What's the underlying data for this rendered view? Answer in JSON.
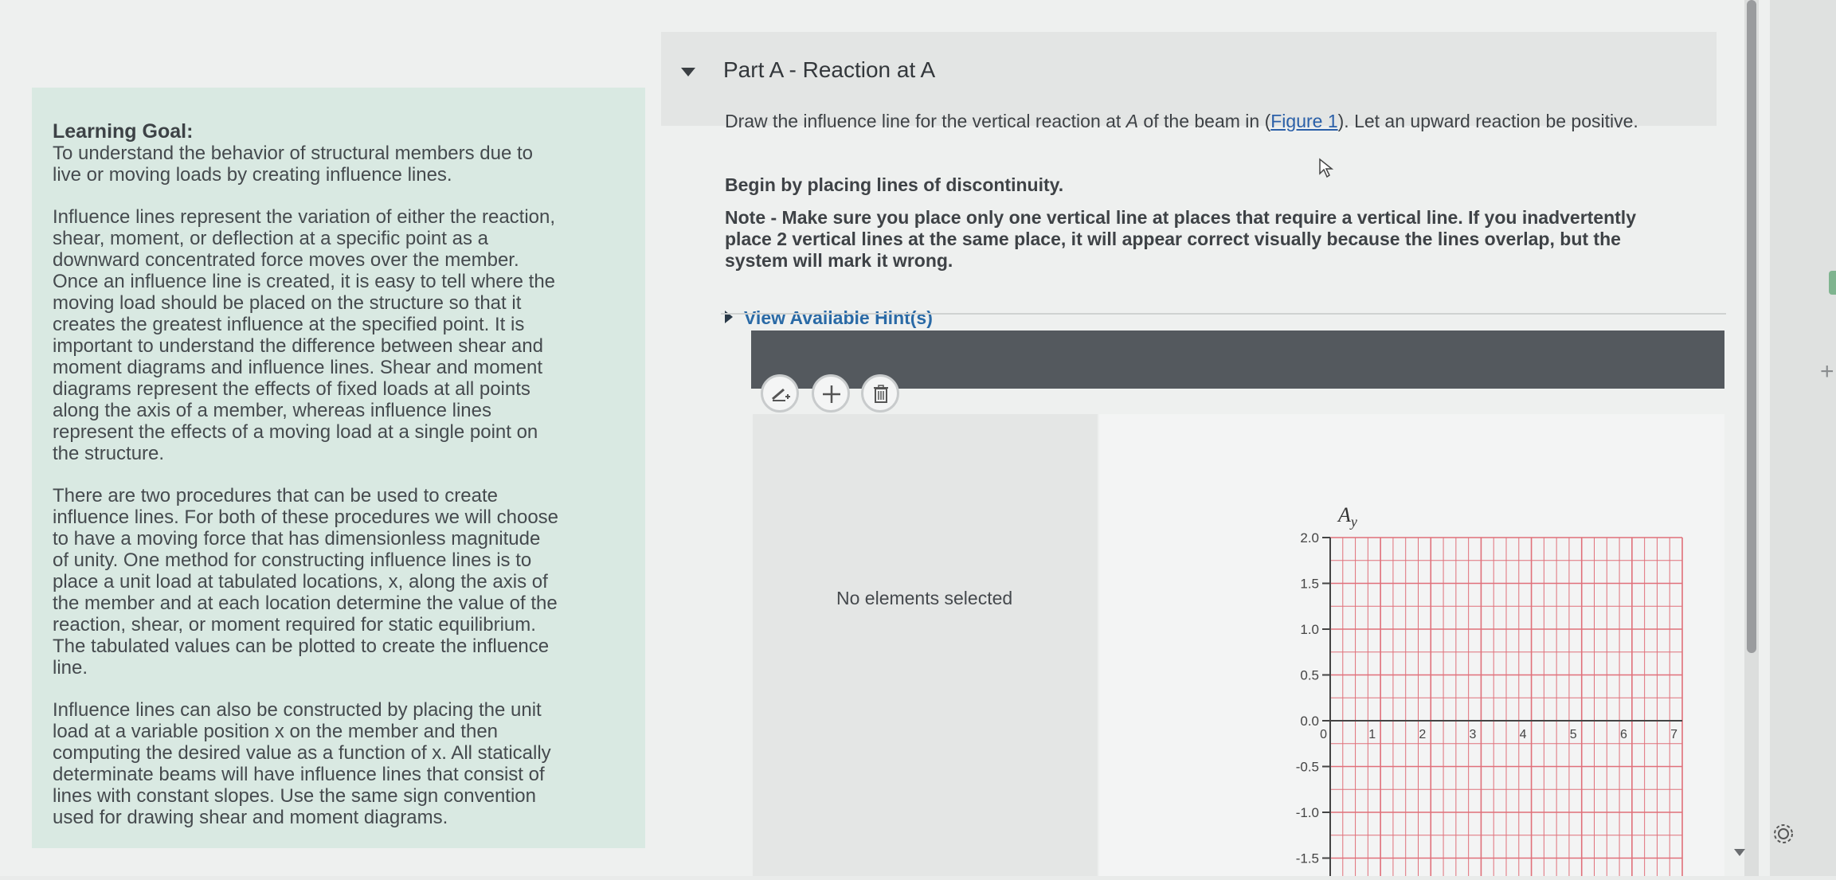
{
  "learning_goal": {
    "heading": "Learning Goal:",
    "paragraphs": [
      "To understand the behavior of structural members due to\nlive or moving loads by creating influence lines.",
      "Influence lines represent the variation of either the reaction,\nshear, moment, or deflection at a specific point as a\ndownward concentrated force moves over the member.\nOnce an influence line is created, it is easy to tell where the\nmoving load should be placed on the structure so that it\ncreates the greatest influence at the specified point. It is\nimportant to understand the difference between shear and\nmoment diagrams and influence lines. Shear and moment\ndiagrams represent the effects of fixed loads at all points\nalong the axis of a member, whereas influence lines\nrepresent the effects of a moving load at a single point on\nthe structure.",
      "There are two procedures that can be used to create\ninfluence lines. For both of these procedures we will choose\nto have a moving force that has dimensionless magnitude\nof unity. One method for constructing influence lines is to\nplace a unit load at tabulated locations, x, along the axis of\nthe member and at each location determine the value of the\nreaction, shear, or moment required for static equilibrium.\nThe tabulated values can be plotted to create the influence\nline.",
      "Influence lines can also be constructed by placing the unit\nload at a variable position x on the member and then\ncomputing the desired value as a function of x. All statically\ndeterminate beams will have influence lines that consist of\nlines with constant slopes. Use the same sign convention\nused for drawing shear and moment diagrams."
    ]
  },
  "part": {
    "title": "Part A - Reaction at A"
  },
  "question": {
    "line1_before": "Draw the influence line for the vertical reaction at ",
    "line1_italic": "A",
    "line1_middle": " of the beam in (",
    "line1_link": "Figure 1",
    "line1_after": "). Let an upward reaction be positive.",
    "line2": "Begin by placing lines of discontinuity.",
    "note": "Note - Make sure you place only one vertical line at places that require a vertical line. If you inadvertently\nplace 2 vertical lines at the same place, it will appear correct visually because the lines overlap, but the\nsystem will mark it wrong.",
    "hint_label": "View Available Hint(s)"
  },
  "toolbar": {
    "icons": [
      "draw-line-icon",
      "add-icon",
      "trash-icon"
    ]
  },
  "selection_panel": {
    "status": "No elements selected"
  },
  "chart_data": {
    "type": "line",
    "ylabel": "Ay",
    "xlim": [
      0,
      7
    ],
    "ylim": [
      -1.5,
      2.0
    ],
    "x_ticks": [
      "0",
      "1",
      "2",
      "3",
      "4",
      "5",
      "6",
      "7"
    ],
    "y_ticks": [
      "2.0",
      "1.5",
      "1.0",
      "0.5",
      "0.0",
      "-0.5",
      "-1.0",
      "-1.5"
    ],
    "y_tick_values": [
      2.0,
      1.5,
      1.0,
      0.5,
      0.0,
      -0.5,
      -1.0,
      -1.5
    ],
    "grid": true,
    "grid_color": "#e0707a",
    "series": []
  }
}
